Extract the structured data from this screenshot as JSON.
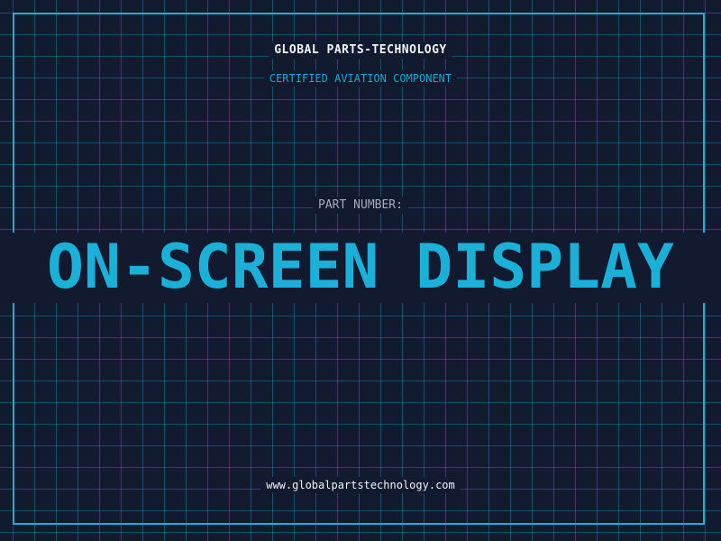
{
  "header": {
    "company": "GLOBAL PARTS-TECHNOLOGY",
    "subtitle": "CERTIFIED AVIATION COMPONENT"
  },
  "part": {
    "label": "PART NUMBER:",
    "value": "ON-SCREEN DISPLAY"
  },
  "footer": {
    "website": "www.globalpartstechnology.com"
  },
  "colors": {
    "background": "#111a2e",
    "grid": "#23789f",
    "accent": "#1ab0d8",
    "text_primary": "#f2f4f8",
    "text_muted": "#a3adbd"
  }
}
